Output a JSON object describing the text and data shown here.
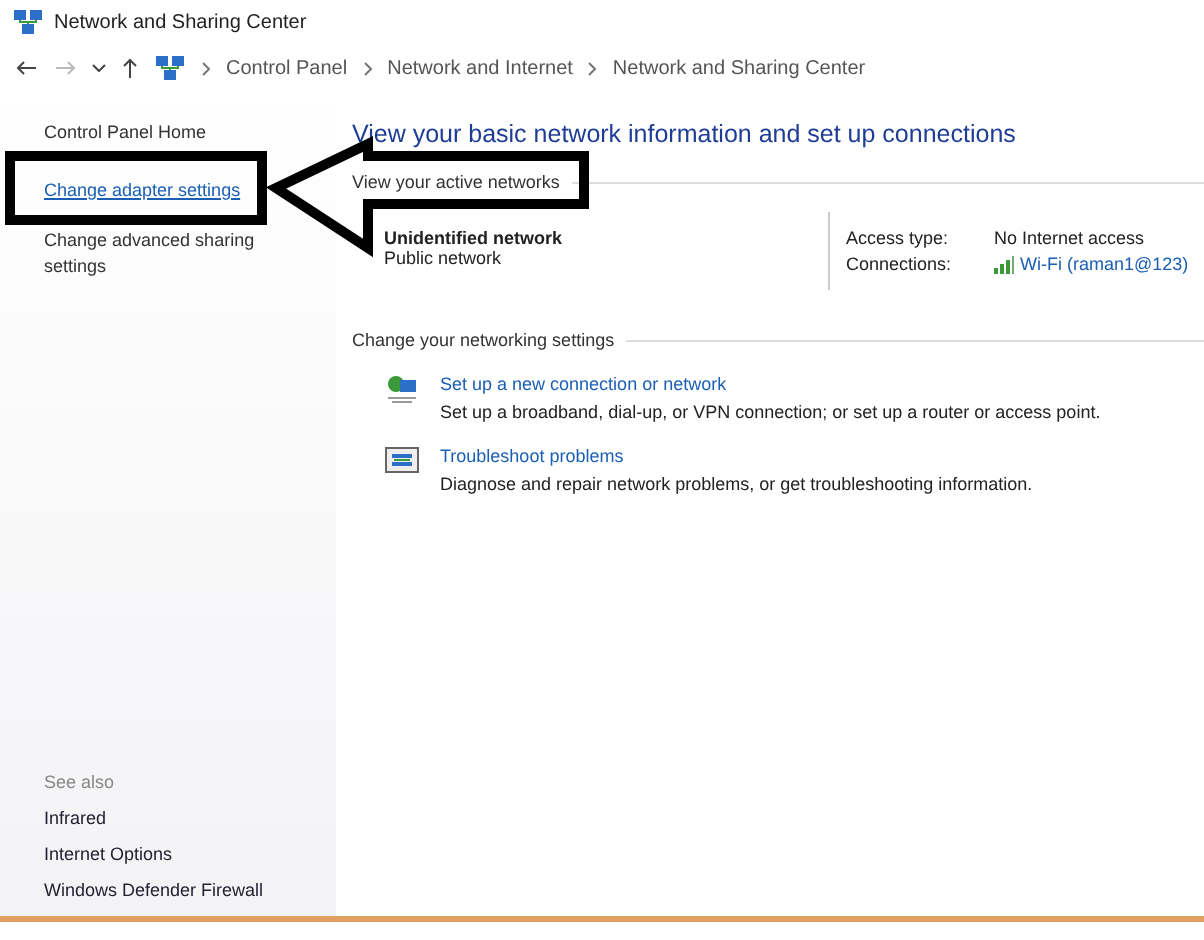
{
  "window": {
    "title": "Network and Sharing Center"
  },
  "address_bar": {
    "breadcrumbs": [
      "Control Panel",
      "Network and Internet",
      "Network and Sharing Center"
    ]
  },
  "sidebar": {
    "items": [
      {
        "label": "Control Panel Home",
        "kind": "plain"
      },
      {
        "label": "Change adapter settings",
        "kind": "link"
      },
      {
        "label": "Change advanced sharing settings",
        "kind": "plain"
      }
    ],
    "see_also": {
      "heading": "See also",
      "items": [
        "Infrared",
        "Internet Options",
        "Windows Defender Firewall"
      ]
    }
  },
  "main": {
    "heading": "View your basic network information and set up connections",
    "active_networks": {
      "heading": "View your active networks",
      "name": "Unidentified network",
      "category": "Public network",
      "access_type_label": "Access type:",
      "access_type": "No Internet access",
      "connections_label": "Connections:",
      "connection": "Wi-Fi (raman1@123)"
    },
    "settings": {
      "heading": "Change your networking settings",
      "items": [
        {
          "kind": "setup",
          "title": "Set up a new connection or network",
          "description": "Set up a broadband, dial-up, or VPN connection; or set up a router or access point."
        },
        {
          "kind": "troubleshoot",
          "title": "Troubleshoot problems",
          "description": "Diagnose and repair network problems, or get troubleshooting information."
        }
      ]
    }
  }
}
